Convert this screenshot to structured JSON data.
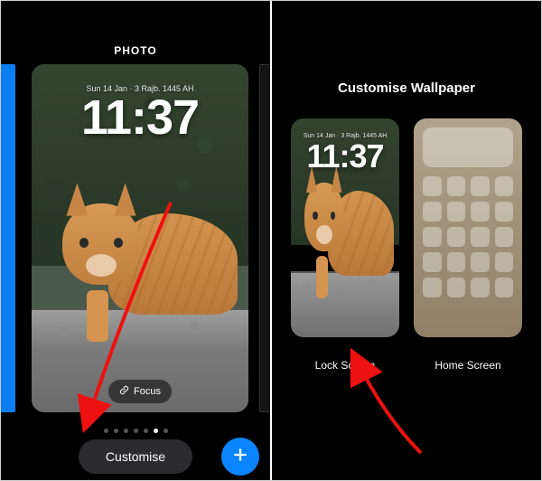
{
  "left": {
    "header_title": "PHOTO",
    "date_line": "Sun 14 Jan · 3 Rajb. 1445 AH",
    "time": "11:37",
    "focus_label": "Focus",
    "customise_label": "Customise",
    "page_count": 7,
    "page_index": 5
  },
  "right": {
    "header_title": "Customise Wallpaper",
    "date_line": "Sun 14 Jan · 3 Rajb. 1445 AH",
    "time": "11:37",
    "lock_label": "Lock Screen",
    "home_label": "Home Screen",
    "home_icon_count": 20
  },
  "colors": {
    "accent": "#0a84ff"
  }
}
